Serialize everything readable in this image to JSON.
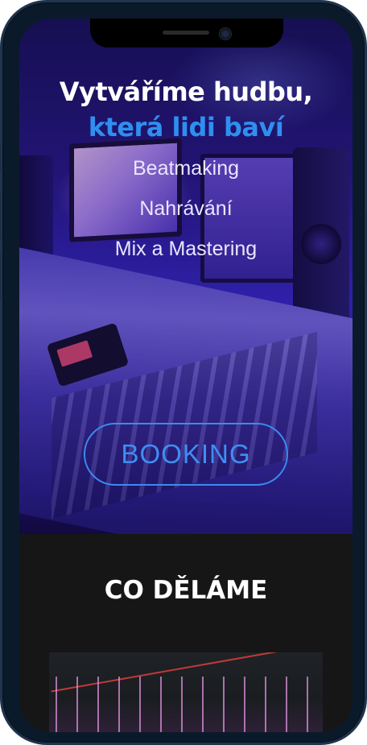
{
  "hero": {
    "title_line1": "Vytváříme hudbu,",
    "title_line2": "která lidi baví",
    "services": [
      "Beatmaking",
      "Nahrávání",
      "Mix a Mastering"
    ],
    "cta_label": "BOOKING"
  },
  "section": {
    "title": "CO DĚLÁME"
  },
  "colors": {
    "accent_blue": "#2f8ff0",
    "page_bg": "#161616",
    "phone_frame": "#0b1a2b"
  }
}
